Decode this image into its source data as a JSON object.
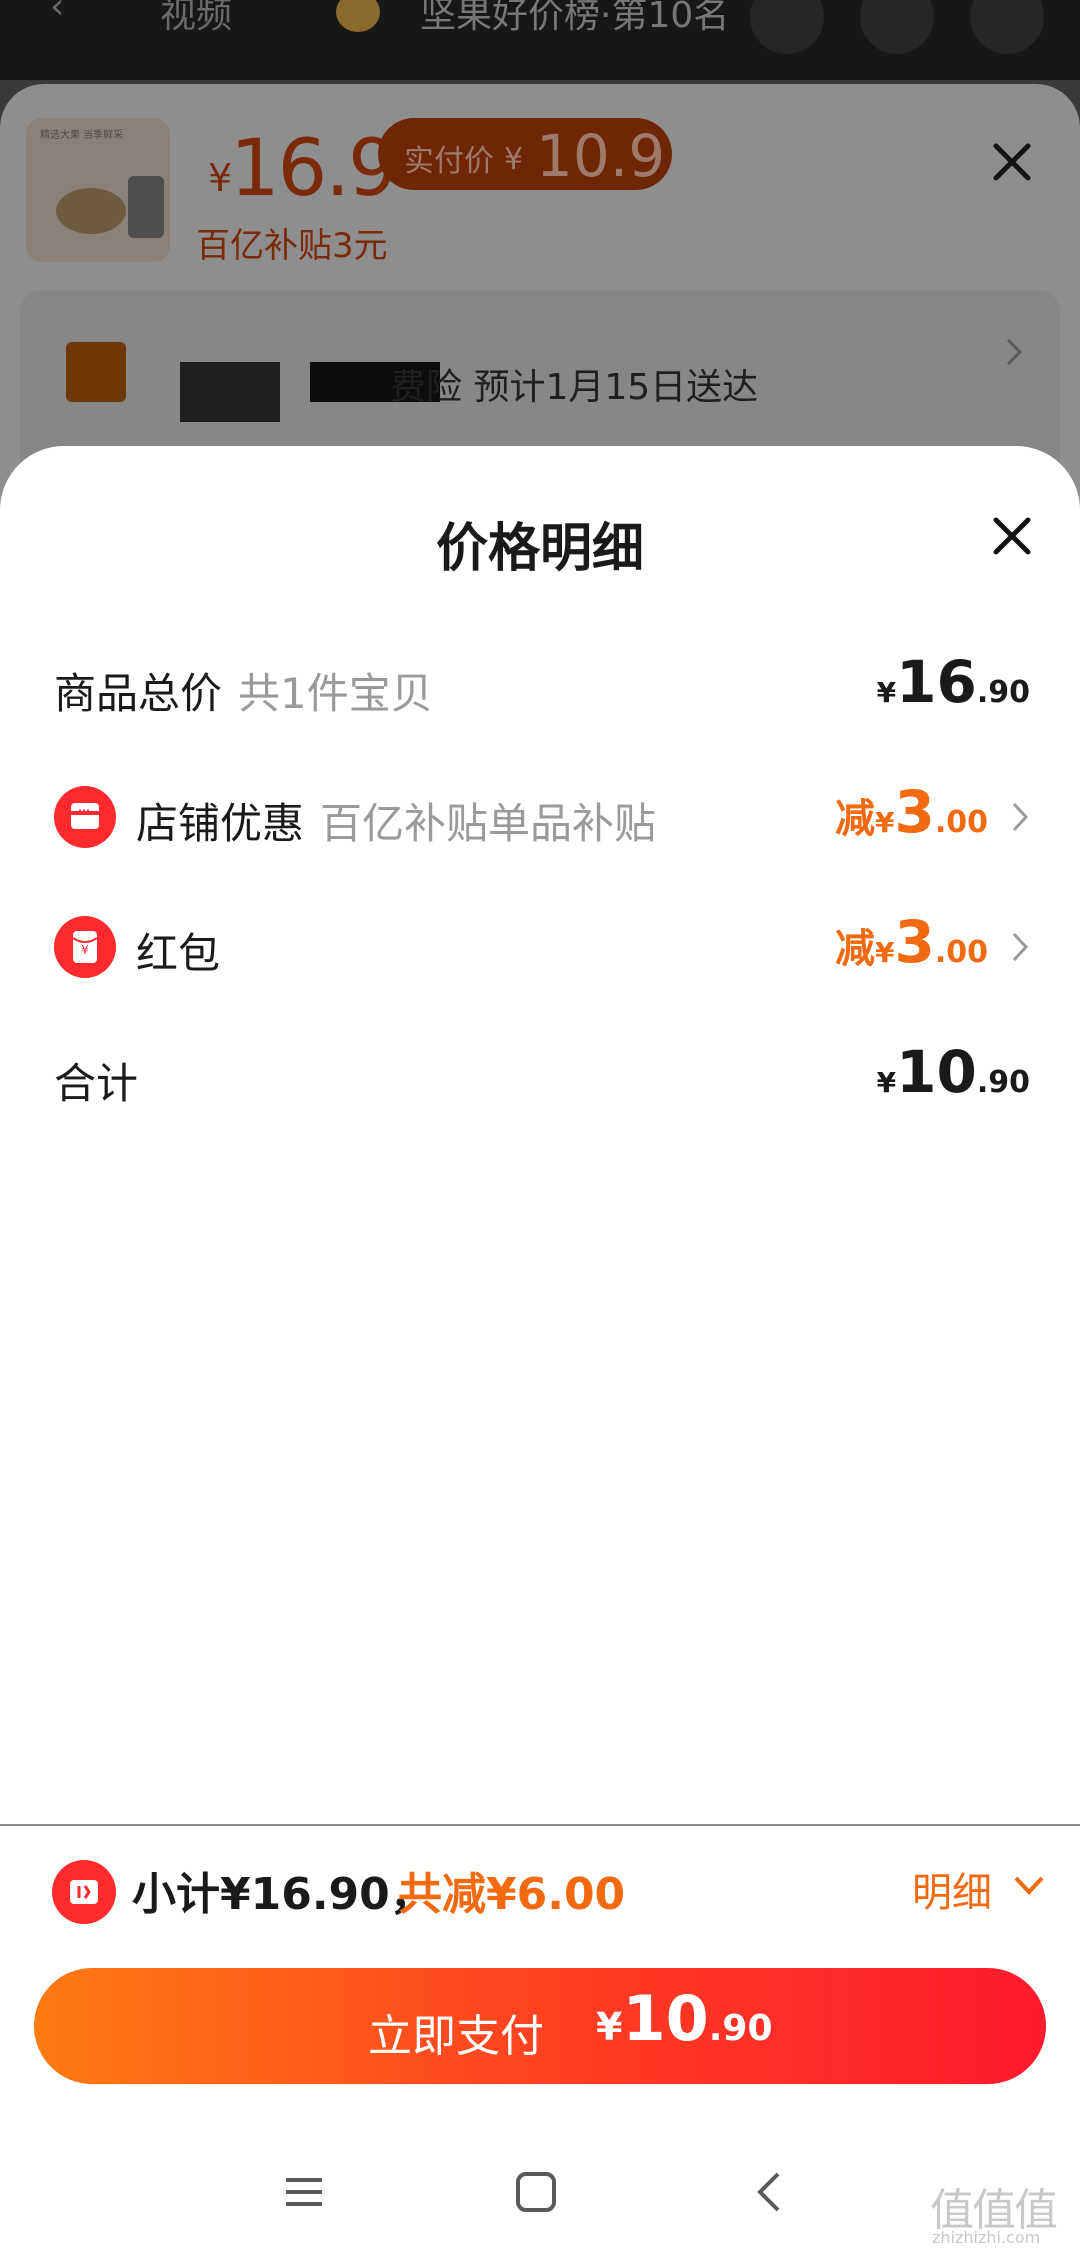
{
  "topbar": {
    "back_glyph": "‹",
    "video_label": "视频",
    "rank_text": "坚果好价榜·第10名"
  },
  "product": {
    "thumb_text": "精选大果 当季鲜采",
    "yen": "¥",
    "price": "16.9",
    "real_pay_label": "实付价",
    "real_pay_yen": "¥",
    "real_pay_value": "10.9",
    "subsidy_text": "百亿补贴3元"
  },
  "shipping": {
    "text": "费险 预计1月15日送达"
  },
  "price_detail": {
    "title": "价格明细",
    "rows": [
      {
        "label": "商品总价",
        "sub": "共1件宝贝",
        "prefix": "",
        "yen": "¥",
        "int": "16",
        "dec": ".90"
      },
      {
        "label": "店铺优惠",
        "sub": "百亿补贴单品补贴",
        "prefix": "减",
        "yen": "¥",
        "int": "3",
        "dec": ".00",
        "icon": "shop-icon"
      },
      {
        "label": "红包",
        "sub": "",
        "prefix": "减",
        "yen": "¥",
        "int": "3",
        "dec": ".00",
        "icon": "red-packet-icon"
      },
      {
        "label": "合计",
        "sub": "",
        "prefix": "",
        "yen": "¥",
        "int": "10",
        "dec": ".90"
      }
    ]
  },
  "footer": {
    "subtotal_text": "小计¥16.90，",
    "saved_text": "共减¥6.00",
    "detail_label": "明细",
    "pay_label": "立即支付",
    "pay_yen": "¥",
    "pay_int": "10",
    "pay_dec": ".90"
  },
  "watermark": {
    "glyphs": "值值值",
    "domain": "zhizhizhi.com"
  },
  "colors": {
    "accent": "#f26a10",
    "red": "#ff2a2e",
    "pay_gradient_start": "#ff7a12",
    "pay_gradient_end": "#ff1a2e"
  }
}
